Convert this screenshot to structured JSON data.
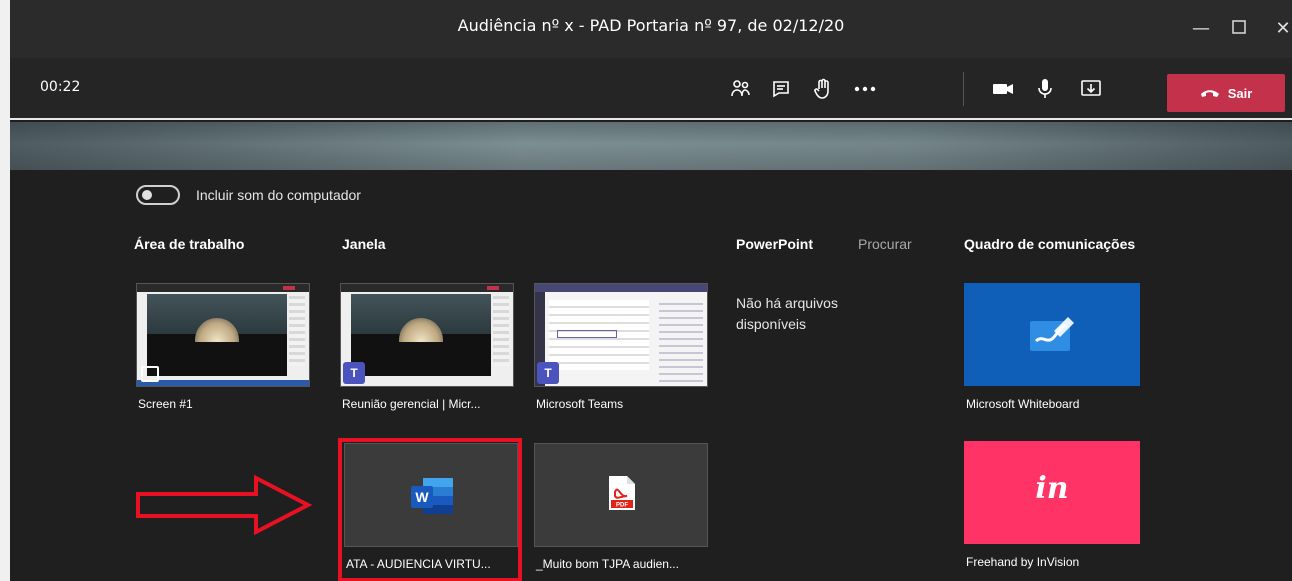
{
  "window": {
    "title": "Audiência nº x - PAD Portaria nº 97, de 02/12/20",
    "controls": [
      "minimize-icon",
      "maximize-icon",
      "close-icon"
    ]
  },
  "toolbar": {
    "timer": "00:22",
    "buttons": [
      "participants-icon",
      "chat-icon",
      "raise-hand-icon",
      "more-icon",
      "camera-icon",
      "microphone-icon",
      "share-icon"
    ],
    "leave_label": "Sair",
    "leave_color": "#c4314b"
  },
  "share_panel": {
    "toggle_label": "Incluir som do computador",
    "toggle_on": false,
    "sections": {
      "desktop": "Área de trabalho",
      "window": "Janela",
      "powerpoint": "PowerPoint",
      "browse": "Procurar",
      "whiteboard": "Quadro de comunicações"
    },
    "desktop_items": [
      {
        "label": "Screen #1"
      }
    ],
    "window_items": [
      {
        "label": "Reunião gerencial | Micr..."
      },
      {
        "label": "Microsoft Teams"
      },
      {
        "label": "ATA - AUDIENCIA VIRTU..."
      },
      {
        "label": "_Muito bom TJPA audien..."
      }
    ],
    "powerpoint_empty": "Não há arquivos disponíveis",
    "whiteboard_items": [
      {
        "label": "Microsoft Whiteboard"
      },
      {
        "label": "Freehand by InVision",
        "logo_text": "in"
      }
    ],
    "word_badge": "W",
    "pdf_badge": "PDF"
  }
}
